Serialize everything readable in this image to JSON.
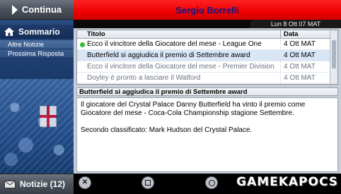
{
  "sidebar": {
    "continue_label": "Continua",
    "section_label": "Sommario",
    "items": [
      {
        "label": "Altre Notizie"
      },
      {
        "label": "Prossima Risposta"
      }
    ],
    "news_label": "Notizie (12)"
  },
  "header": {
    "title": "Sergio Borrelli",
    "date": "Lun 8 Ott 07 MAT"
  },
  "news_list": {
    "columns": {
      "title": "Titolo",
      "date": "Data"
    },
    "rows": [
      {
        "title": "Ecco il vincitore della Giocatore del mese - League One",
        "date": "4 Ott MAT",
        "status": "unread"
      },
      {
        "title": "Butterfield si aggiudica il premio di Settembre award",
        "date": "4 Ott MAT",
        "status": "selected"
      },
      {
        "title": "Ecco il vincitore della Giocatore del mese - Premier Division",
        "date": "4 Ott MAT",
        "status": "read"
      },
      {
        "title": "Doyley è pronto a lasciare il Watford",
        "date": "4 Ott MAT",
        "status": "read"
      }
    ]
  },
  "detail": {
    "title": "Butterfield si aggiudica il premio di Settembre award",
    "paragraph1": "Il giocatore del Crystal Palace Danny Butterfield ha vinto il premio come Giocatore del mese - Coca-Cola Championship stagione Settembre.",
    "paragraph2": "Secondo classificato: Mark Hudson del Crystal Palace."
  },
  "bottom_bar": {
    "watermark": "GAMEKAPOCS"
  },
  "colors": {
    "title_bar": "#ee0000",
    "title_text": "#0b1a8a",
    "unread_dot": "#2ec02e"
  }
}
